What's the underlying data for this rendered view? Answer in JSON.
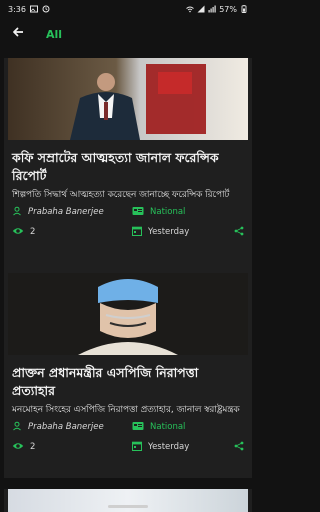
{
  "status_bar": {
    "time": "3:36",
    "battery": "57%"
  },
  "header": {
    "title": "All",
    "back_icon": "back-arrow-icon"
  },
  "articles": [
    {
      "headline": "কফি সম্রাটের আত্মহত্যা জানাল ফরেন্সিক রিপোর্ট",
      "summary": "শিল্পপতি সিদ্ধার্থ আত্মহত্যা করেছেন জানাচ্ছে ফরেন্সিক রিপোর্ট",
      "author": "Prabaha Banerjee",
      "category": "National",
      "views": "2",
      "date": "Yesterday"
    },
    {
      "headline": "প্রাক্তন প্রধানমন্ত্রীর এসপিজি নিরাপত্তা প্রত্যাহার",
      "summary": "মনমোহন সিংহের এসপিজি নিরাপত্তা প্রত্যাহার, জানাল স্বরাষ্ট্রমন্ত্রক",
      "author": "Prabaha Banerjee",
      "category": "National",
      "views": "2",
      "date": "Yesterday"
    }
  ],
  "colors": {
    "accent": "#27c15a",
    "background": "#121212",
    "card": "#1f1f1f"
  }
}
